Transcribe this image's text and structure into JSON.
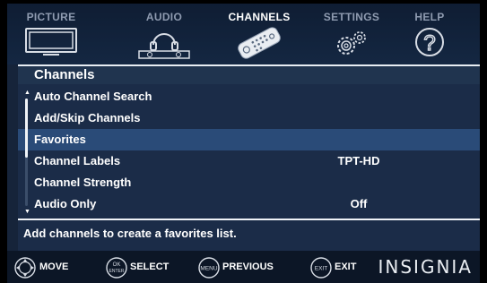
{
  "tabs": [
    {
      "label": "PICTURE",
      "icon": "tv-icon",
      "active": false
    },
    {
      "label": "AUDIO",
      "icon": "headphones-icon",
      "active": false
    },
    {
      "label": "CHANNELS",
      "icon": "remote-icon",
      "active": true
    },
    {
      "label": "SETTINGS",
      "icon": "gears-icon",
      "active": false
    },
    {
      "label": "HELP",
      "icon": "question-icon",
      "active": false
    }
  ],
  "panel": {
    "title": "Channels",
    "items": [
      {
        "label": "Auto Channel Search",
        "value": ""
      },
      {
        "label": "Add/Skip Channels",
        "value": ""
      },
      {
        "label": "Favorites",
        "value": "",
        "selected": true
      },
      {
        "label": "Channel Labels",
        "value": "TPT-HD"
      },
      {
        "label": "Channel Strength",
        "value": ""
      },
      {
        "label": "Audio Only",
        "value": "Off"
      }
    ],
    "hint": "Add channels to create a favorites list."
  },
  "footer": {
    "move_label": "MOVE",
    "select_label": "SELECT",
    "select_key_top": "OK",
    "select_key_bottom": "ENTER",
    "previous_label": "PREVIOUS",
    "previous_key": "MENU",
    "exit_label": "EXIT",
    "exit_key": "EXIT",
    "brand": "INSIGNIA"
  },
  "colors": {
    "accent_selected": "#2a4b78",
    "panel_bg": "#1b2c48",
    "tab_bg": "#0f1d33"
  }
}
